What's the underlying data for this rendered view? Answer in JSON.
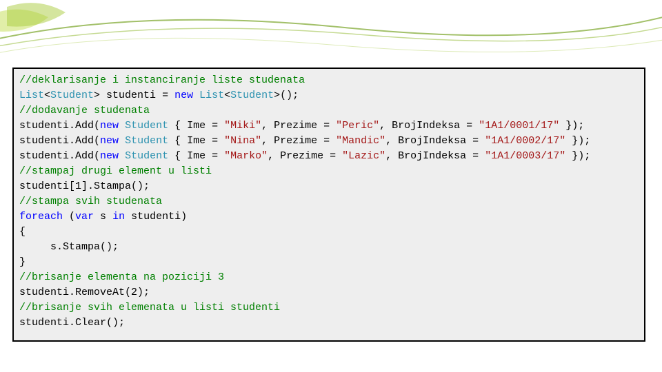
{
  "code": {
    "c1": "//deklarisanje i instanciranje liste studenata",
    "l2_a": "List",
    "l2_b": "<",
    "l2_c": "Student",
    "l2_d": "> studenti = ",
    "l2_e": "new",
    "l2_f": " List",
    "l2_g": "<",
    "l2_h": "Student",
    "l2_i": ">();",
    "c3": "//dodavanje studenata",
    "l4_a": "studenti.Add(",
    "l4_b": "new",
    "l4_c": " ",
    "l4_d": "Student",
    "l4_e": " { Ime = ",
    "l4_f": "\"Miki\"",
    "l4_g": ", Prezime = ",
    "l4_h": "\"Peric\"",
    "l4_i": ", BrojIndeksa = ",
    "l4_j": "\"1A1/0001/17\"",
    "l4_k": " });",
    "l5_a": "studenti.Add(",
    "l5_b": "new",
    "l5_c": " ",
    "l5_d": "Student",
    "l5_e": " { Ime = ",
    "l5_f": "\"Nina\"",
    "l5_g": ", Prezime = ",
    "l5_h": "\"Mandic\"",
    "l5_i": ", BrojIndeksa = ",
    "l5_j": "\"1A1/0002/17\"",
    "l5_k": " });",
    "l6_a": "studenti.Add(",
    "l6_b": "new",
    "l6_c": " ",
    "l6_d": "Student",
    "l6_e": " { Ime = ",
    "l6_f": "\"Marko\"",
    "l6_g": ", Prezime = ",
    "l6_h": "\"Lazic\"",
    "l6_i": ", BrojIndeksa = ",
    "l6_j": "\"1A1/0003/17\"",
    "l6_k": " });",
    "c7": "//stampaj drugi element u listi",
    "l8": "studenti[1].Stampa();",
    "c9": "//stampa svih studenata",
    "l10_a": "foreach",
    "l10_b": " (",
    "l10_c": "var",
    "l10_d": " s ",
    "l10_e": "in",
    "l10_f": " studenti)",
    "l11": "{",
    "l12": "     s.Stampa();",
    "l13": "}",
    "c14": "//brisanje elementa na poziciji 3",
    "l15": "studenti.RemoveAt(2);",
    "c16": "//brisanje svih elemenata u listi studenti",
    "l17": "studenti.Clear();"
  }
}
